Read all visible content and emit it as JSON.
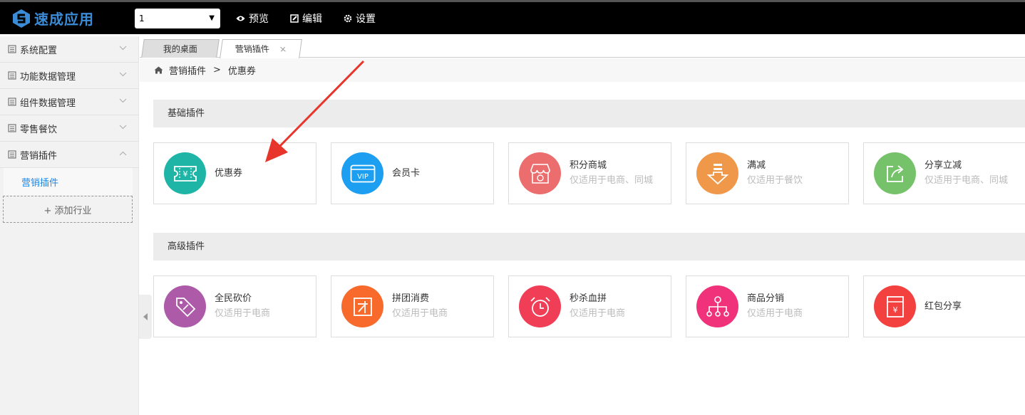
{
  "header": {
    "logo_text": "速成应用",
    "app_select_value": "1",
    "nav": [
      {
        "label": "预览",
        "icon": "eye-icon"
      },
      {
        "label": "编辑",
        "icon": "edit-icon"
      },
      {
        "label": "设置",
        "icon": "gear-icon"
      }
    ]
  },
  "sidebar": {
    "items": [
      {
        "label": "系统配置",
        "expanded": false
      },
      {
        "label": "功能数据管理",
        "expanded": false
      },
      {
        "label": "组件数据管理",
        "expanded": false
      },
      {
        "label": "零售餐饮",
        "expanded": false
      },
      {
        "label": "营销插件",
        "expanded": true
      }
    ],
    "sub_item": "营销插件",
    "add_label": "+ 添加行业"
  },
  "tabs": {
    "desktop": "我的桌面",
    "active": "营销插件",
    "close": "×"
  },
  "breadcrumb": {
    "parent": "营销插件",
    "separator": ">",
    "current": "优惠券"
  },
  "basic": {
    "title": "基础插件",
    "cards": [
      {
        "title": "优惠券",
        "sub": "",
        "color": "#1fb5a6",
        "icon": "coupon-icon"
      },
      {
        "title": "会员卡",
        "sub": "",
        "color": "#1c9ff0",
        "icon": "vip-card-icon"
      },
      {
        "title": "积分商城",
        "sub": "仅适用于电商、同城",
        "color": "#ec6d6d",
        "icon": "shop-icon"
      },
      {
        "title": "满减",
        "sub": "仅适用于餐饮",
        "color": "#f0984a",
        "icon": "discount-icon"
      },
      {
        "title": "分享立减",
        "sub": "仅适用于电商、同城",
        "color": "#76c26a",
        "icon": "share-icon"
      }
    ]
  },
  "advanced": {
    "title": "高级插件",
    "cards": [
      {
        "title": "全民砍价",
        "sub": "仅适用于电商",
        "color": "#ad5aa8",
        "icon": "price-tag-icon"
      },
      {
        "title": "拼团消费",
        "sub": "仅适用于电商",
        "color": "#f86a2c",
        "icon": "group-buy-icon"
      },
      {
        "title": "秒杀血拼",
        "sub": "仅适用于电商",
        "color": "#ef3e56",
        "icon": "alarm-clock-icon"
      },
      {
        "title": "商品分销",
        "sub": "仅适用于电商",
        "color": "#f0327a",
        "icon": "distribution-icon"
      },
      {
        "title": "红包分享",
        "sub": "",
        "color": "#f2413e",
        "icon": "red-packet-icon"
      }
    ]
  }
}
